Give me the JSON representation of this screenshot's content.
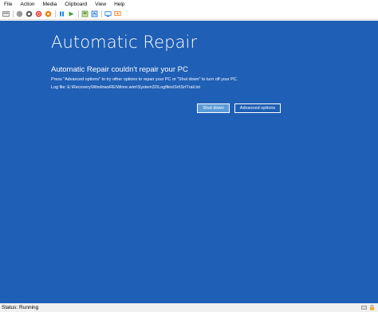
{
  "menu": {
    "file": "File",
    "action": "Action",
    "media": "Media",
    "clipboard": "Clipboard",
    "view": "View",
    "help": "Help"
  },
  "toolbar": {
    "icons": [
      "ctrl-alt-del-icon",
      "start-icon",
      "turn-off-icon",
      "shut-down-icon",
      "save-icon",
      "pause-icon",
      "reset-icon",
      "checkpoint-icon",
      "revert-icon",
      "enhanced-session-icon",
      "share-icon"
    ]
  },
  "repair": {
    "title": "Automatic Repair",
    "subtitle": "Automatic Repair couldn't repair your PC",
    "description": "Press \"Advanced options\" to try other options to repair your PC or \"Shut down\" to turn off your PC.",
    "log_file": "Log file: E:\\Recovery\\WindowsRE\\Winre.wim\\System32\\Logfiles\\Srt\\SrtTrail.txt",
    "shutdown_label": "Shut down",
    "advanced_label": "Advanced options"
  },
  "status": {
    "text": "Status: Running"
  },
  "colors": {
    "screen_bg": "#1f5fb5",
    "primary_button_bg": "#5b9bd8"
  }
}
